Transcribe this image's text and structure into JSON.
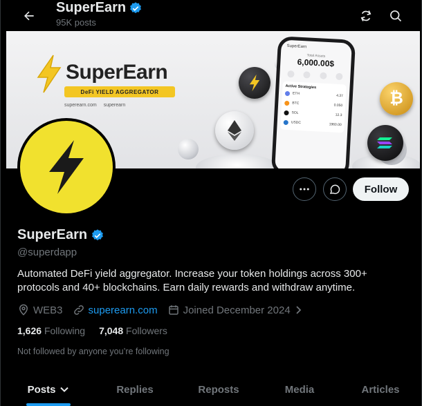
{
  "header": {
    "title": "SuperEarn",
    "subtitle": "95K posts"
  },
  "banner": {
    "brand": "SuperEarn",
    "tagline": "DeFi YIELD AGGREGATOR",
    "website": "superearn.com",
    "handle": "superearn",
    "phone": {
      "app_name": "SuperEarn",
      "total_label": "Total Assets",
      "total_value": "6,000.00$",
      "strategies_title": "Active Strategies",
      "rows": [
        {
          "coin": "ETH",
          "value": "4.37"
        },
        {
          "coin": "BTC",
          "value": "0.050"
        },
        {
          "coin": "SOL",
          "value": "12.3"
        },
        {
          "coin": "USDC",
          "value": "1960.00"
        }
      ]
    }
  },
  "profile": {
    "name": "SuperEarn",
    "handle": "@superdapp",
    "bio": "Automated DeFi yield aggregator. Increase your token holdings across 300+ protocols and 40+ blockchains. Earn daily rewards and withdraw anytime.",
    "location": "WEB3",
    "website": "superearn.com",
    "joined": "Joined December 2024",
    "following_count": "1,626",
    "following_label": "Following",
    "followers_count": "7,048",
    "followers_label": "Followers",
    "not_followed": "Not followed by anyone you’re following"
  },
  "actions": {
    "follow_label": "Follow"
  },
  "tabs": [
    {
      "label": "Posts",
      "active": true
    },
    {
      "label": "Replies",
      "active": false
    },
    {
      "label": "Reposts",
      "active": false
    },
    {
      "label": "Media",
      "active": false
    },
    {
      "label": "Articles",
      "active": false
    }
  ],
  "colors": {
    "accent": "#1d9bf0",
    "brand_yellow": "#f1e12e",
    "background": "#000000"
  },
  "icons": [
    "back-arrow-icon",
    "verified-badge-icon",
    "refresh-icon",
    "search-icon",
    "more-icon",
    "message-icon",
    "location-icon",
    "link-icon",
    "calendar-icon",
    "chevron-right-icon",
    "chevron-down-icon",
    "bolt-icon"
  ]
}
